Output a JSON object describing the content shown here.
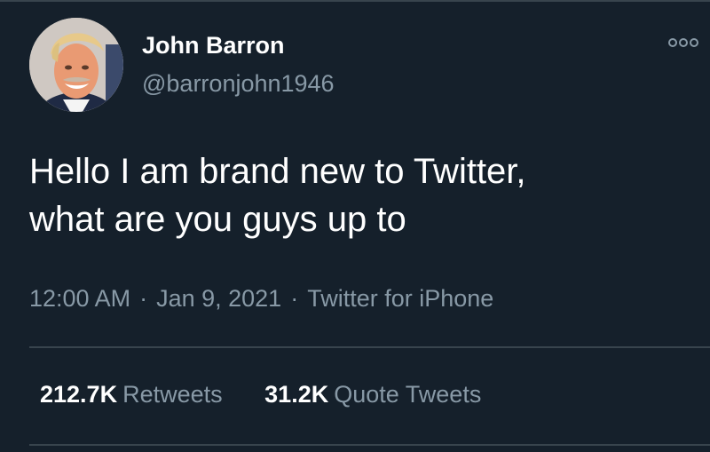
{
  "user": {
    "display_name": "John Barron",
    "handle": "@barronjohn1946"
  },
  "tweet": {
    "text_line1": "Hello I am brand new to Twitter,",
    "text_line2": "what are you guys up to"
  },
  "meta": {
    "time": "12:00 AM",
    "date": "Jan 9, 2021",
    "source": "Twitter for iPhone",
    "separator": "·"
  },
  "stats": {
    "retweets_count": "212.7K",
    "retweets_label": "Retweets",
    "quote_count": "31.2K",
    "quote_label": "Quote Tweets"
  },
  "icons": {
    "more": "more-icon",
    "avatar": "profile-photo"
  },
  "colors": {
    "background": "#15202b",
    "primary_text": "#ffffff",
    "secondary_text": "#8899a6",
    "divider": "#38444d"
  }
}
